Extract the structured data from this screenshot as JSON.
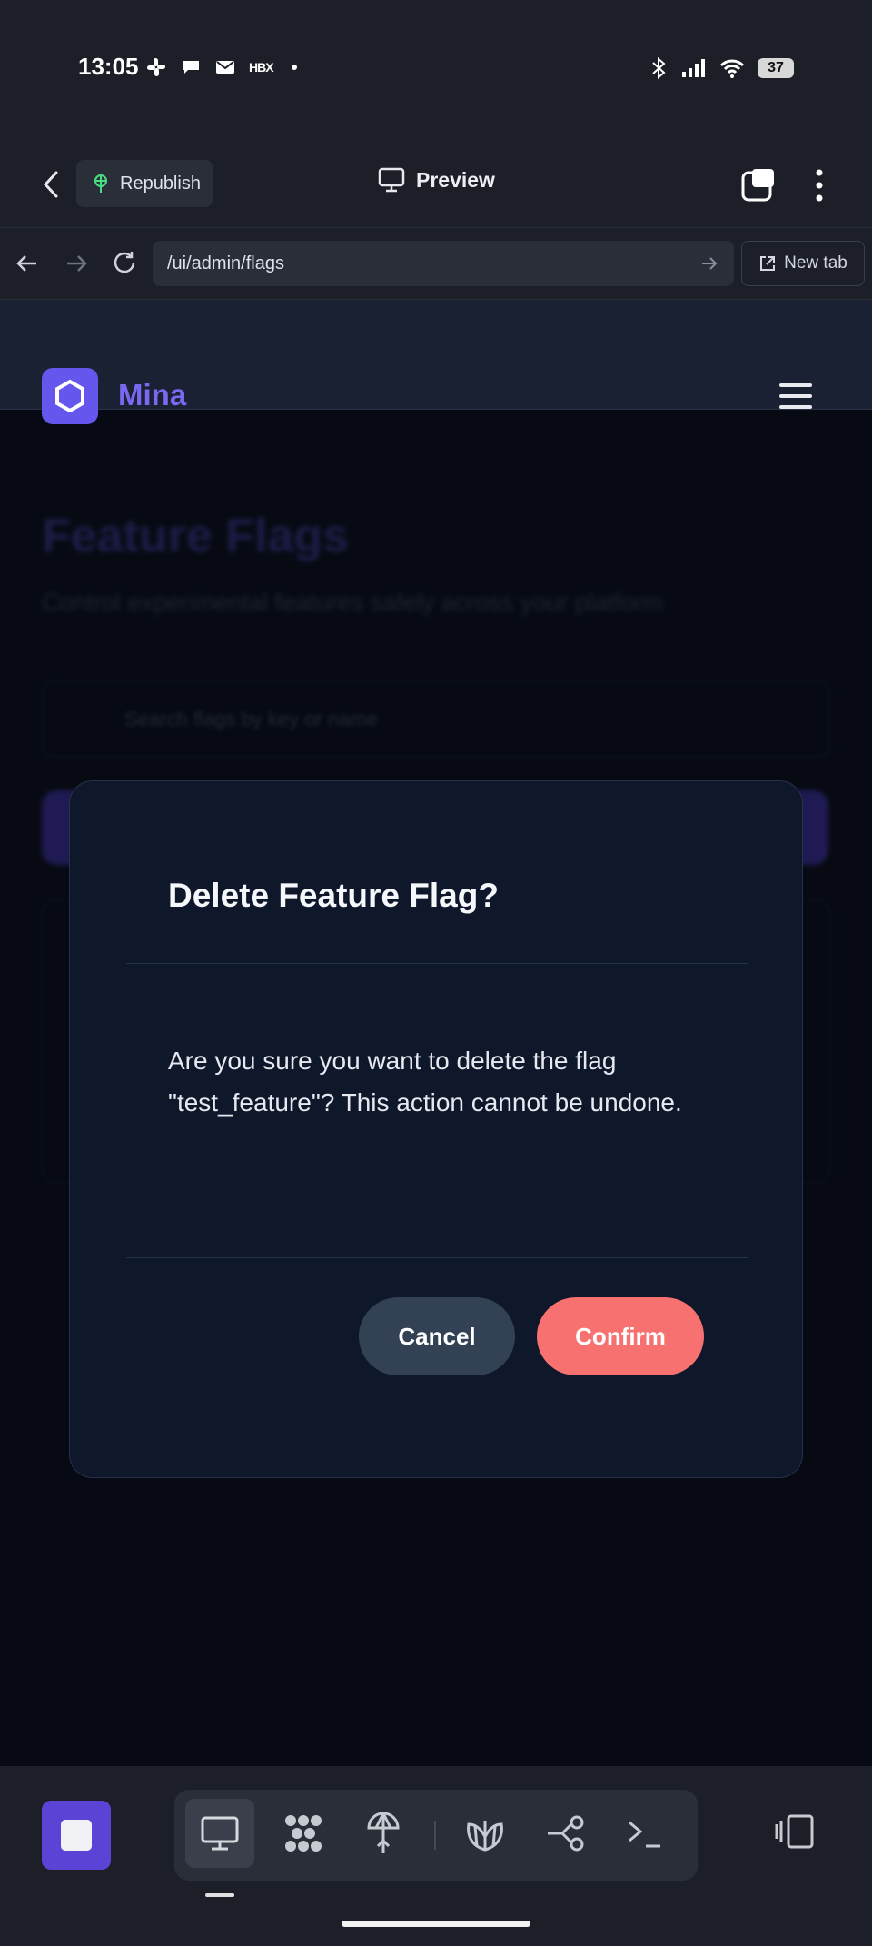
{
  "status_bar": {
    "time": "13:05",
    "battery": "37",
    "left_icons": [
      "slack-icon",
      "chat-icon",
      "mail-icon",
      "hbx-icon",
      "dot-icon"
    ],
    "right_icons": [
      "bluetooth-icon",
      "signal-icon",
      "wifi-icon",
      "battery-icon"
    ],
    "hbx_label": "HBX"
  },
  "app_bar": {
    "republish_label": "Republish",
    "preview_label": "Preview"
  },
  "url_bar": {
    "url": "/ui/admin/flags",
    "new_tab_label": "New tab"
  },
  "site": {
    "brand": "Mina",
    "page_title": "Feature Flags",
    "page_subtitle": "Control experimental features safely across your platform",
    "search_placeholder": "Search flags by key or name"
  },
  "modal": {
    "title": "Delete Feature Flag?",
    "message": "Are you sure you want to delete the flag \"test_feature\"? This action cannot be undone.",
    "cancel_label": "Cancel",
    "confirm_label": "Confirm"
  },
  "colors": {
    "accent": "#6557ee",
    "confirm": "#f87171",
    "cancel": "#334155",
    "modal_bg": "#0f172a"
  },
  "bottom_toolbar": {
    "tools": [
      "monitor-icon",
      "apps-icon",
      "deploy-icon",
      "shell-icon",
      "branch-icon",
      "terminal-icon"
    ],
    "active_tool": "monitor-icon"
  }
}
